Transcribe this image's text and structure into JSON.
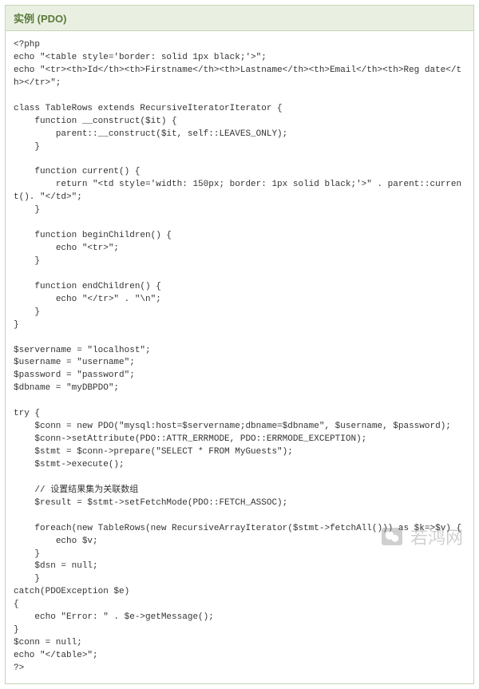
{
  "header": {
    "title": "实例 (PDO)"
  },
  "code": "<?php \necho \"<table style='border: solid 1px black;'>\"; \necho \"<tr><th>Id</th><th>Firstname</th><th>Lastname</th><th>Email</th><th>Reg date</th></tr>\"; \n \nclass TableRows extends RecursiveIteratorIterator { \n    function __construct($it) { \n        parent::__construct($it, self::LEAVES_ONLY); \n    } \n \n    function current() { \n        return \"<td style='width: 150px; border: 1px solid black;'>\" . parent::current(). \"</td>\"; \n    } \n \n    function beginChildren() { \n        echo \"<tr>\"; \n    } \n \n    function endChildren() { \n        echo \"</tr>\" . \"\\n\"; \n    } \n} \n \n$servername = \"localhost\"; \n$username = \"username\"; \n$password = \"password\"; \n$dbname = \"myDBPDO\"; \n \ntry { \n    $conn = new PDO(\"mysql:host=$servername;dbname=$dbname\", $username, $password); \n    $conn->setAttribute(PDO::ATTR_ERRMODE, PDO::ERRMODE_EXCEPTION); \n    $stmt = $conn->prepare(\"SELECT * FROM MyGuests\"); \n    $stmt->execute(); \n \n    // 设置结果集为关联数组 \n    $result = $stmt->setFetchMode(PDO::FETCH_ASSOC); \n \n    foreach(new TableRows(new RecursiveArrayIterator($stmt->fetchAll())) as $k=>$v) { \n        echo $v; \n    } \n    $dsn = null; \n    } \ncatch(PDOException $e) \n{ \n    echo \"Error: \" . $e->getMessage(); \n} \n$conn = null; \necho \"</table>\"; \n?>",
  "watermark": {
    "text": "若鸿网"
  }
}
